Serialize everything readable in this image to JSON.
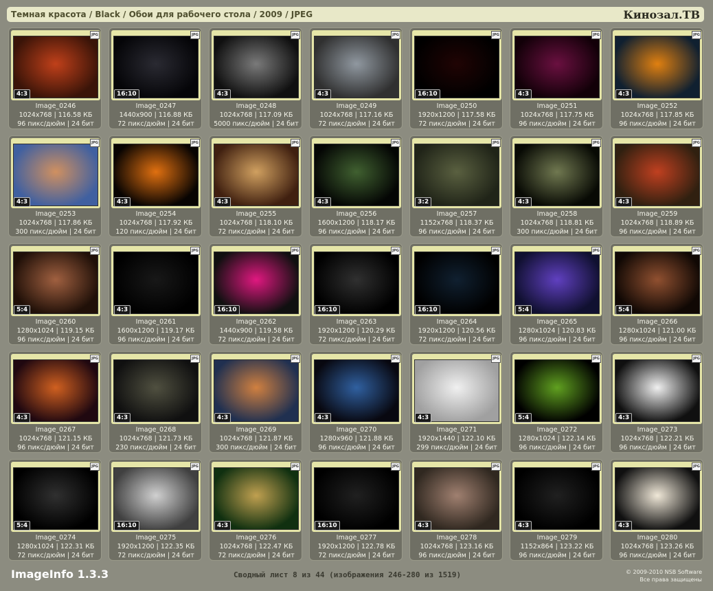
{
  "header": {
    "breadcrumb": "Темная красота / Black / Обои для рабочего стола / 2009 / JPEG",
    "brand": "Кинозал.ТВ"
  },
  "colors": {
    "background": "#8c8c80",
    "tile": "#6f6f64",
    "frame": "#e6e6a8",
    "header": "#e8e8c8"
  },
  "format_badge": "JPG",
  "tiles": [
    {
      "name": "Image_0246",
      "res": "1024x768 | 116.58 КБ",
      "dpi": "96 пикс/дюйм | 24 бит",
      "ratio": "4:3",
      "colors": [
        "#c0401a",
        "#3a1408"
      ]
    },
    {
      "name": "Image_0247",
      "res": "1440x900 | 116.88 КБ",
      "dpi": "72 пикс/дюйм | 24 бит",
      "ratio": "16:10",
      "colors": [
        "#2a2a32",
        "#050508"
      ]
    },
    {
      "name": "Image_0248",
      "res": "1024x768 | 117.09 КБ",
      "dpi": "5000 пикс/дюйм | 24 бит",
      "ratio": "4:3",
      "colors": [
        "#7a7a7a",
        "#101010"
      ]
    },
    {
      "name": "Image_0249",
      "res": "1024x768 | 117.16 КБ",
      "dpi": "72 пикс/дюйм | 24 бит",
      "ratio": "4:3",
      "colors": [
        "#9098a0",
        "#303030"
      ]
    },
    {
      "name": "Image_0250",
      "res": "1920x1200 | 117.58 КБ",
      "dpi": "72 пикс/дюйм | 24 бит",
      "ratio": "16:10",
      "colors": [
        "#200404",
        "#000000"
      ]
    },
    {
      "name": "Image_0251",
      "res": "1024x768 | 117.75 КБ",
      "dpi": "96 пикс/дюйм | 24 бит",
      "ratio": "4:3",
      "colors": [
        "#6a1040",
        "#120008"
      ]
    },
    {
      "name": "Image_0252",
      "res": "1024x768 | 117.85 КБ",
      "dpi": "96 пикс/дюйм | 24 бит",
      "ratio": "4:3",
      "colors": [
        "#e08010",
        "#102030"
      ]
    },
    {
      "name": "Image_0253",
      "res": "1024x768 | 117.86 КБ",
      "dpi": "300 пикс/дюйм | 24 бит",
      "ratio": "4:3",
      "colors": [
        "#d09060",
        "#4060a0"
      ]
    },
    {
      "name": "Image_0254",
      "res": "1024x768 | 117.92 КБ",
      "dpi": "120 пикс/дюйм | 24 бит",
      "ratio": "4:3",
      "colors": [
        "#e07010",
        "#080402"
      ]
    },
    {
      "name": "Image_0255",
      "res": "1024x768 | 118.10 КБ",
      "dpi": "72 пикс/дюйм | 24 бит",
      "ratio": "4:3",
      "colors": [
        "#d0a060",
        "#402010"
      ]
    },
    {
      "name": "Image_0256",
      "res": "1600x1200 | 118.17 КБ",
      "dpi": "96 пикс/дюйм | 24 бит",
      "ratio": "4:3",
      "colors": [
        "#406030",
        "#040604"
      ]
    },
    {
      "name": "Image_0257",
      "res": "1152x768 | 118.37 КБ",
      "dpi": "96 пикс/дюйм | 24 бит",
      "ratio": "3:2",
      "colors": [
        "#5a6040",
        "#202418"
      ]
    },
    {
      "name": "Image_0258",
      "res": "1024x768 | 118.81 КБ",
      "dpi": "300 пикс/дюйм | 24 бит",
      "ratio": "4:3",
      "colors": [
        "#707850",
        "#080a04"
      ]
    },
    {
      "name": "Image_0259",
      "res": "1024x768 | 118.89 КБ",
      "dpi": "96 пикс/дюйм | 24 бит",
      "ratio": "4:3",
      "colors": [
        "#c04020",
        "#302010"
      ]
    },
    {
      "name": "Image_0260",
      "res": "1280x1024 | 119.15 КБ",
      "dpi": "96 пикс/дюйм | 24 бит",
      "ratio": "5:4",
      "colors": [
        "#a06040",
        "#201008"
      ]
    },
    {
      "name": "Image_0261",
      "res": "1600x1200 | 119.17 КБ",
      "dpi": "96 пикс/дюйм | 24 бит",
      "ratio": "4:3",
      "colors": [
        "#181818",
        "#000000"
      ]
    },
    {
      "name": "Image_0262",
      "res": "1440x900 | 119.58 КБ",
      "dpi": "72 пикс/дюйм | 24 бит",
      "ratio": "16:10",
      "colors": [
        "#e01880",
        "#101010"
      ]
    },
    {
      "name": "Image_0263",
      "res": "1920x1200 | 120.29 КБ",
      "dpi": "72 пикс/дюйм | 24 бит",
      "ratio": "16:10",
      "colors": [
        "#303030",
        "#000000"
      ]
    },
    {
      "name": "Image_0264",
      "res": "1920x1200 | 120.56 КБ",
      "dpi": "72 пикс/дюйм | 24 бит",
      "ratio": "16:10",
      "colors": [
        "#102030",
        "#000000"
      ]
    },
    {
      "name": "Image_0265",
      "res": "1280x1024 | 120.83 КБ",
      "dpi": "96 пикс/дюйм | 24 бит",
      "ratio": "5:4",
      "colors": [
        "#6040c0",
        "#101030"
      ]
    },
    {
      "name": "Image_0266",
      "res": "1280x1024 | 121.00 КБ",
      "dpi": "96 пикс/дюйм | 24 бит",
      "ratio": "5:4",
      "colors": [
        "#905030",
        "#100804"
      ]
    },
    {
      "name": "Image_0267",
      "res": "1024x768 | 121.15 КБ",
      "dpi": "96 пикс/дюйм | 24 бит",
      "ratio": "4:3",
      "colors": [
        "#d06020",
        "#200810"
      ]
    },
    {
      "name": "Image_0268",
      "res": "1024x768 | 121.73 КБ",
      "dpi": "230 пикс/дюйм | 24 бит",
      "ratio": "4:3",
      "colors": [
        "#505040",
        "#101010"
      ]
    },
    {
      "name": "Image_0269",
      "res": "1024x768 | 121.87 КБ",
      "dpi": "300 пикс/дюйм | 24 бит",
      "ratio": "4:3",
      "colors": [
        "#d08040",
        "#203050"
      ]
    },
    {
      "name": "Image_0270",
      "res": "1280x960 | 121.88 КБ",
      "dpi": "96 пикс/дюйм | 24 бит",
      "ratio": "4:3",
      "colors": [
        "#3060a0",
        "#080810"
      ]
    },
    {
      "name": "Image_0271",
      "res": "1920x1440 | 122.10 КБ",
      "dpi": "299 пикс/дюйм | 24 бит",
      "ratio": "4:3",
      "colors": [
        "#f0f0f0",
        "#a0a0a0"
      ]
    },
    {
      "name": "Image_0272",
      "res": "1280x1024 | 122.14 КБ",
      "dpi": "96 пикс/дюйм | 24 бит",
      "ratio": "5:4",
      "colors": [
        "#60a020",
        "#000000"
      ]
    },
    {
      "name": "Image_0273",
      "res": "1024x768 | 122.21 КБ",
      "dpi": "96 пикс/дюйм | 24 бит",
      "ratio": "4:3",
      "colors": [
        "#f0f0f0",
        "#101010"
      ]
    },
    {
      "name": "Image_0274",
      "res": "1280x1024 | 122.31 КБ",
      "dpi": "72 пикс/дюйм | 24 бит",
      "ratio": "5:4",
      "colors": [
        "#303030",
        "#000000"
      ]
    },
    {
      "name": "Image_0275",
      "res": "1920x1200 | 122.35 КБ",
      "dpi": "72 пикс/дюйм | 24 бит",
      "ratio": "16:10",
      "colors": [
        "#d0d0d0",
        "#404040"
      ]
    },
    {
      "name": "Image_0276",
      "res": "1024x768 | 122.47 КБ",
      "dpi": "72 пикс/дюйм | 24 бит",
      "ratio": "4:3",
      "colors": [
        "#c0a050",
        "#103010"
      ]
    },
    {
      "name": "Image_0277",
      "res": "1920x1200 | 122.78 КБ",
      "dpi": "72 пикс/дюйм | 24 бит",
      "ratio": "16:10",
      "colors": [
        "#202020",
        "#000000"
      ]
    },
    {
      "name": "Image_0278",
      "res": "1024x768 | 123.16 КБ",
      "dpi": "96 пикс/дюйм | 24 бит",
      "ratio": "4:3",
      "colors": [
        "#a08070",
        "#302820"
      ]
    },
    {
      "name": "Image_0279",
      "res": "1152x864 | 123.22 КБ",
      "dpi": "96 пикс/дюйм | 24 бит",
      "ratio": "4:3",
      "colors": [
        "#202020",
        "#000000"
      ]
    },
    {
      "name": "Image_0280",
      "res": "1024x768 | 123.26 КБ",
      "dpi": "96 пикс/дюйм | 24 бит",
      "ratio": "4:3",
      "colors": [
        "#f0e8d8",
        "#101010"
      ]
    }
  ],
  "footer": {
    "app_name": "ImageInfo 1.3.3",
    "summary": "Сводный лист 8 из 44 (изображения 246-280 из 1519)",
    "copyright": "© 2009-2010 NSB Software",
    "rights": "Все права защищены"
  }
}
